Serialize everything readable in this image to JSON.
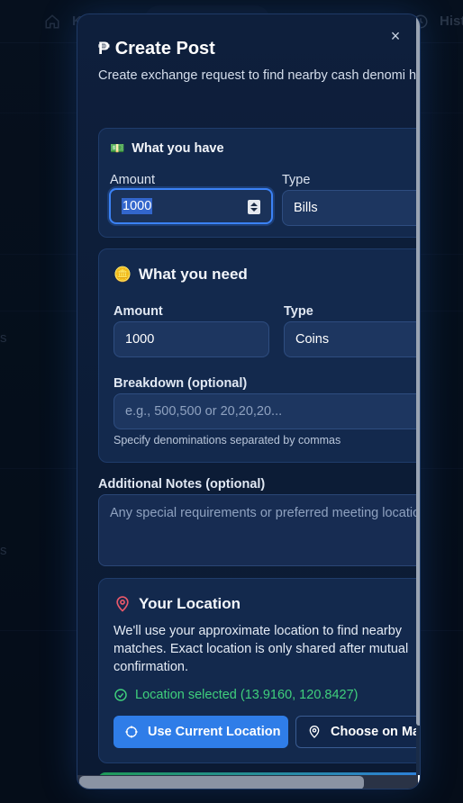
{
  "background": {
    "nav_letter": "K",
    "nav_history": "Hist",
    "side_text_1": "s",
    "side_text_2": "s"
  },
  "modal": {
    "title_icon": "₱",
    "title": "Create Post",
    "close_label": "×",
    "subtitle": "Create exchange request to find nearby cash denomi help."
  },
  "have": {
    "icon": "💵",
    "heading": "What you have",
    "amount_label": "Amount",
    "amount_value": "1000",
    "type_label": "Type",
    "type_value": "Bills"
  },
  "need": {
    "icon": "🪙",
    "heading": "What you need",
    "amount_label": "Amount",
    "amount_value": "1000",
    "type_label": "Type",
    "type_value": "Coins",
    "breakdown_label": "Breakdown (optional)",
    "breakdown_placeholder": "e.g., 500,500 or 20,20,20...",
    "breakdown_hint": "Specify denominations separated by commas"
  },
  "notes": {
    "label": "Additional Notes (optional)",
    "placeholder": "Any special requirements or preferred meeting locations..."
  },
  "location": {
    "heading": "Your Location",
    "description": "We'll use your approximate location to find nearby matches. Exact location is only shared after mutual confirmation.",
    "selected": "Location selected (13.9160, 120.8427)",
    "use_current_label": "Use Current Location",
    "choose_map_label": "Choose on Ma"
  },
  "colors": {
    "accent": "#2f7de8",
    "success": "#3fcf7c",
    "pin": "#e8586a"
  }
}
